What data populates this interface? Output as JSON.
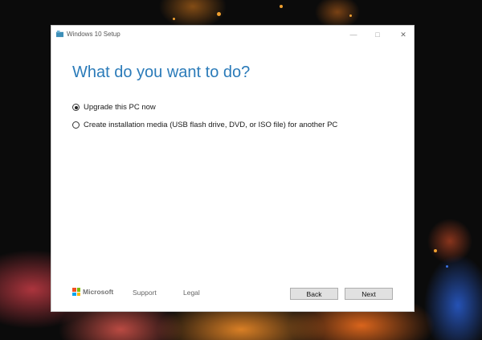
{
  "window": {
    "title": "Windows 10 Setup",
    "heading": "What do you want to do?"
  },
  "options": [
    {
      "label": "Upgrade this PC now",
      "selected": true
    },
    {
      "label": "Create installation media (USB flash drive, DVD, or ISO file) for another PC",
      "selected": false
    }
  ],
  "footer": {
    "brand": "Microsoft",
    "support_label": "Support",
    "legal_label": "Legal",
    "back_label": "Back",
    "next_label": "Next"
  },
  "colors": {
    "heading": "#2b7bb9",
    "ms_red": "#f25022",
    "ms_green": "#7fba00",
    "ms_blue": "#00a4ef",
    "ms_yellow": "#ffb900"
  }
}
